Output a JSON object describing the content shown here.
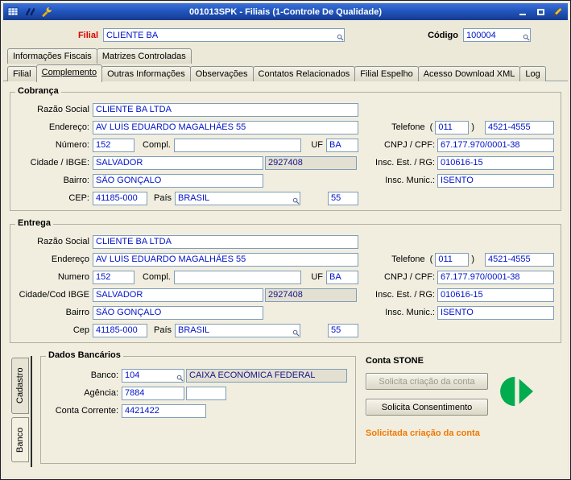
{
  "window": {
    "title": "001013SPK - Filiais (1-Controle De Qualidade)"
  },
  "header": {
    "filial_label": "Filial",
    "filial_value": "CLIENTE BA",
    "codigo_label": "Código",
    "codigo_value": "100004"
  },
  "upper_tabs": [
    {
      "label": "Informações Fiscais"
    },
    {
      "label": "Matrizes Controladas"
    }
  ],
  "main_tabs": [
    {
      "label": "Filial"
    },
    {
      "label": "Complemento",
      "selected": true
    },
    {
      "label": "Outras Informações"
    },
    {
      "label": "Observações"
    },
    {
      "label": "Contatos Relacionados"
    },
    {
      "label": "Filial Espelho"
    },
    {
      "label": "Acesso Download XML"
    },
    {
      "label": "Log"
    }
  ],
  "cobranca": {
    "title": "Cobrança",
    "labels": {
      "razao": "Razão Social",
      "endereco": "Endereço:",
      "numero": "Número:",
      "compl": "Compl.",
      "uf": "UF",
      "cidade": "Cidade / IBGE:",
      "bairro": "Bairro:",
      "cep": "CEP:",
      "pais": "País",
      "telefone": "Telefone",
      "paren_open": "(",
      "paren_close": ")",
      "cnpj": "CNPJ / CPF:",
      "insc_est": "Insc. Est. / RG:",
      "insc_mun": "Insc. Munic.:"
    },
    "values": {
      "razao": "CLIENTE BA LTDA",
      "endereco": "AV LUÍS EDUARDO MAGALHÃES 55",
      "numero": "152",
      "compl": "",
      "uf": "BA",
      "cidade": "SALVADOR",
      "ibge": "2927408",
      "bairro": "SÃO GONÇALO",
      "cep": "41185-000",
      "pais": "BRASIL",
      "pais_cod": "55",
      "ddd": "011",
      "fone": "4521-4555",
      "cnpj": "67.177.970/0001-38",
      "insc_est": "010616-15",
      "insc_mun": "ISENTO"
    }
  },
  "entrega": {
    "title": "Entrega",
    "labels": {
      "razao": "Razão Social",
      "endereco": "Endereço",
      "numero": "Numero",
      "compl": "Compl.",
      "uf": "UF",
      "cidade": "Cidade/Cod IBGE",
      "bairro": "Bairro",
      "cep": "Cep",
      "pais": "País",
      "telefone": "Telefone",
      "paren_open": "(",
      "paren_close": ")",
      "cnpj": "CNPJ / CPF:",
      "insc_est": "Insc. Est. / RG:",
      "insc_mun": "Insc. Munic.:"
    },
    "values": {
      "razao": "CLIENTE BA LTDA",
      "endereco": "AV LUÍS EDUARDO MAGALHÃES 55",
      "numero": "152",
      "compl": "",
      "uf": "BA",
      "cidade": "SALVADOR",
      "ibge": "2927408",
      "bairro": "SÃO GONÇALO",
      "cep": "41185-000",
      "pais": "BRASIL",
      "pais_cod": "55",
      "ddd": "011",
      "fone": "4521-4555",
      "cnpj": "67.177.970/0001-38",
      "insc_est": "010616-15",
      "insc_mun": "ISENTO"
    }
  },
  "side_tabs": {
    "cadastro": "Cadastro",
    "banco": "Banco"
  },
  "dados_bancarios": {
    "title": "Dados Bancários",
    "banco_label": "Banco:",
    "banco_cod": "104",
    "banco_nome": "CAIXA ECONÔMICA FEDERAL",
    "agencia_label": "Agência:",
    "agencia": "7884",
    "agencia_dv": "",
    "conta_label": "Conta Corrente:",
    "conta": "4421422"
  },
  "conta_stone": {
    "title": "Conta STONE",
    "btn_criacao": "Solicita criação da conta",
    "btn_consentimento": "Solicita Consentimento",
    "status": "Solicitada criação da conta"
  },
  "colors": {
    "field_text": "#0012C8",
    "filial_label_red": "#E00000",
    "status_orange": "#F07800",
    "stone_green": "#00AC4E",
    "titlebar_blue": "#2257BE"
  }
}
